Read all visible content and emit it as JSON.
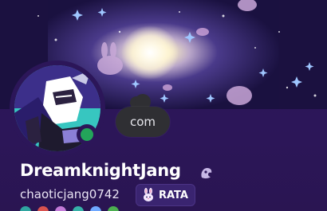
{
  "profile": {
    "display_name": "DreamknightJang",
    "username": "chaoticjang0742",
    "status_bubble_text": "com",
    "status": "online",
    "server_tag": {
      "label": "RATA",
      "icon": "bunny-icon"
    },
    "name_icon": "nitro-icon",
    "badges": [
      {
        "icon": "badge-active-developer-icon",
        "color": "#2fa6a0"
      },
      {
        "icon": "badge-red-icon",
        "color": "#d9534f"
      },
      {
        "icon": "badge-pink-icon",
        "color": "#c37ad8"
      },
      {
        "icon": "badge-teal-icon",
        "color": "#36b1a8"
      },
      {
        "icon": "badge-blue-icon",
        "color": "#6fa8ff"
      },
      {
        "icon": "badge-green-icon",
        "color": "#4caf50"
      }
    ]
  },
  "colors": {
    "card_background": "#2c1659",
    "online": "#23a55a",
    "bubble": "#2f2f33",
    "tag_pill": "#3a2470"
  }
}
